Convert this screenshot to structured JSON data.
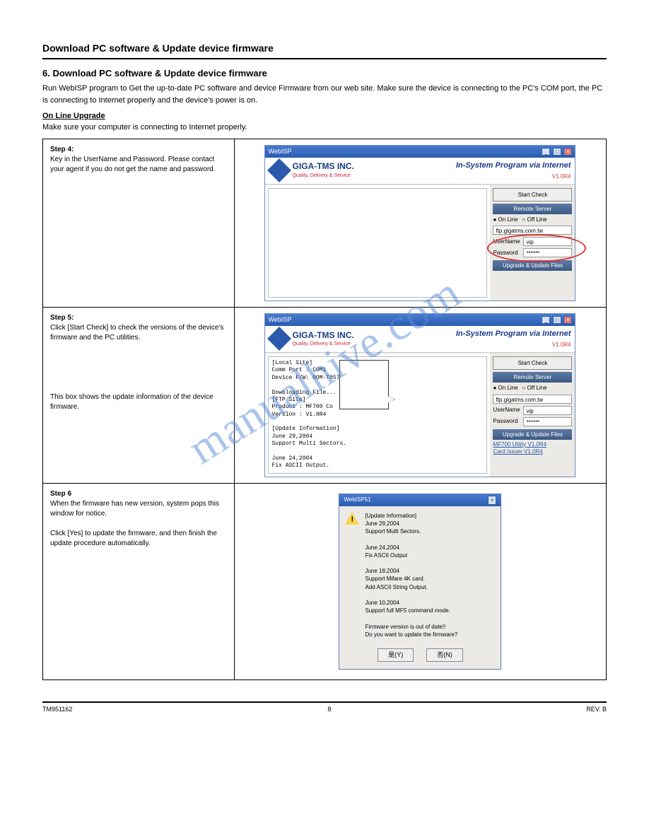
{
  "header": {
    "title": "Download PC software & Update device firmware"
  },
  "doc": {
    "section_title": "6. Download PC software & Update device firmware",
    "intro": "Run WebISP program to Get the up-to-date PC software and device Firmware from our web site. Make sure the device is connecting to the PC's COM port, the PC is connecting to Internet properly and the device's power is on.",
    "sub_heading": "On Line Upgrade",
    "sub_intro": "Make sure your computer is connecting to Internet properly."
  },
  "steps": {
    "s4": {
      "label": "Step 4:",
      "text": "Key in the UserName and Password. Please contact your agent if you do not get the name and password."
    },
    "s5": {
      "label": "Step 5:",
      "text1": "Click [Start Check] to check the versions of the device's firmware and the PC utilities.",
      "text2": "This box shows the update information of the device firmware."
    },
    "s6": {
      "label": "Step 6",
      "text1": "When the firmware has new version, system pops this window for notice.",
      "text2": "Click [Yes] to update the firmware, and then finish the update procedure automatically."
    }
  },
  "win": {
    "title": "WebISP",
    "company": "GIGA-TMS INC.",
    "slogan": "Quality, Delivery & Service",
    "program": "In-System Program via Internet",
    "version": "V1.0R4",
    "start_check": "Start Check",
    "remote_server": "Remote Server",
    "online": "On Line",
    "offline": "Off Line",
    "ftp": "ftp.gigatms.com.tw",
    "username_lbl": "UserName",
    "username_val": "vip",
    "password_lbl": "Password",
    "password_val": "******",
    "upgrade_files": "Upgrade & Update Files",
    "file1": "MF700 Utility V1.0R4",
    "file2": "Card Issuer V1.0R4"
  },
  "log": {
    "l1": "[Local Site]",
    "l2": "Comm Port : COM1",
    "l3": "Device F/W: ROM-T057",
    "l4": "Downloading File...",
    "l5": "[FTP Site]",
    "l6": "Product   : MF700 Co",
    "l7": "Version   : V1.0R4",
    "l8": "[Update Information]",
    "l9": "June 29,2004",
    "l10": "  Support Multi Sectors.",
    "l11": "June 24,2004",
    "l12": "  Fix ASCII Output."
  },
  "dialog": {
    "title": "WebISP51",
    "h1": "[Update Information]",
    "d1a": "June 29,2004",
    "d1b": "Support Multi Sectors.",
    "d2a": "June 24,2004",
    "d2b": "Fix ASCII Output",
    "d3a": "June 18,2004",
    "d3b": "Support Mifare 4K card.",
    "d3c": "Add ASCII String Output.",
    "d4a": "June 10,2004",
    "d4b": "Support full MF5 command mode.",
    "warn1": "Firmware version is out of date!!",
    "warn2": "Do you want to update the firmware?",
    "yes": "是(Y)",
    "no": "否(N)"
  },
  "footer": {
    "doc": "TM951162",
    "rev": "REV. B"
  },
  "watermark": "manualhive.com"
}
